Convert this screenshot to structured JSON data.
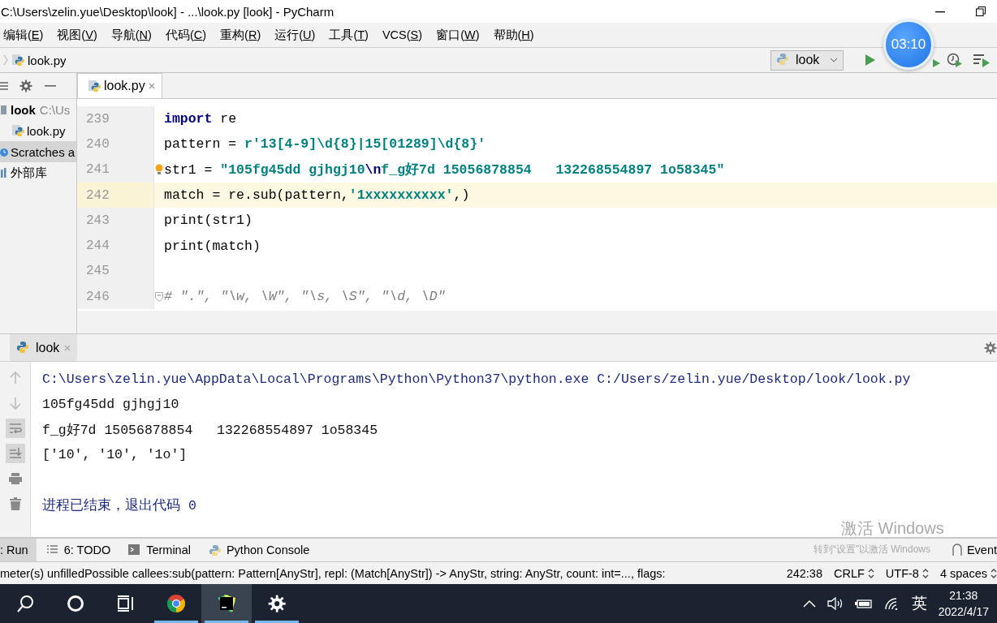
{
  "window": {
    "title": "C:\\Users\\zelin.yue\\Desktop\\look] - ...\\look.py [look] - PyCharm"
  },
  "menu": [
    "编辑(E)",
    "视图(V)",
    "导航(N)",
    "代码(C)",
    "重构(R)",
    "运行(U)",
    "工具(T)",
    "VCS(S)",
    "窗口(W)",
    "帮助(H)"
  ],
  "breadcrumb": {
    "file": "look.py"
  },
  "run_config": {
    "label": "look"
  },
  "timer": {
    "time": "03:10"
  },
  "project": {
    "items": [
      {
        "name": "look",
        "path": "C:\\Us",
        "kind": "folder",
        "selected": false,
        "children": [
          {
            "name": "look.py",
            "kind": "python",
            "selected": false
          }
        ]
      },
      {
        "name": "Scratches a",
        "kind": "scratches",
        "selected": true
      },
      {
        "name": "外部库",
        "kind": "library",
        "selected": false
      }
    ]
  },
  "editor": {
    "tabs": [
      {
        "label": "look.py",
        "selected": true
      }
    ],
    "lines": [
      {
        "number": "239",
        "current": false,
        "tokens": [
          {
            "kind": "keyword",
            "text": "import"
          },
          {
            "kind": "plain",
            "text": " re"
          }
        ]
      },
      {
        "number": "240",
        "current": false,
        "tokens": [
          {
            "kind": "plain",
            "text": "pattern = "
          },
          {
            "kind": "string",
            "text": "r'13[4-9]\\d{8}|15[01289]\\d{8}'"
          }
        ]
      },
      {
        "number": "241",
        "current": false,
        "hint": true,
        "tokens": [
          {
            "kind": "plain",
            "text": "str1 = "
          },
          {
            "kind": "string",
            "text": "\"105fg45dd gjhgj10"
          },
          {
            "kind": "escape",
            "text": "\\n"
          },
          {
            "kind": "string",
            "text": "f_g好7d 15056878854   132268554897 1o58345\""
          }
        ]
      },
      {
        "number": "242",
        "current": true,
        "tokens": [
          {
            "kind": "plain",
            "text": "match = re.sub(pattern,"
          },
          {
            "kind": "string",
            "text": "'1xxxxxxxxxx'"
          },
          {
            "kind": "plain",
            "text": ",)"
          }
        ]
      },
      {
        "number": "243",
        "current": false,
        "tokens": [
          {
            "kind": "plain",
            "text": "print(str1)"
          }
        ]
      },
      {
        "number": "244",
        "current": false,
        "tokens": [
          {
            "kind": "plain",
            "text": "print(match)"
          }
        ]
      },
      {
        "number": "245",
        "current": false
      },
      {
        "number": "246",
        "current": false,
        "fold": true,
        "tokens": [
          {
            "kind": "comment",
            "text": "# \".\", \"\\w, \\W\", \"\\s, \\S\", \"\\d, \\D\""
          }
        ]
      }
    ]
  },
  "run_panel": {
    "tabs": [
      {
        "label": "look",
        "selected": true
      }
    ],
    "output": [
      {
        "kind": "command",
        "text": "C:\\Users\\zelin.yue\\AppData\\Local\\Programs\\Python\\Python37\\python.exe C:/Users/zelin.yue/Desktop/look/look.py"
      },
      {
        "kind": "output",
        "text": "105fg45dd gjhgj10"
      },
      {
        "kind": "output",
        "text": "f_g好7d 15056878854   132268554897 1o58345"
      },
      {
        "kind": "output",
        "text": "['10', '10', '1o']"
      },
      {
        "kind": "exit",
        "text": "进程已结束，退出代码 0"
      }
    ]
  },
  "tool_windows": [
    {
      "label": ": Run",
      "kind": "run",
      "selected": true
    },
    {
      "label": "6: TODO",
      "kind": "todo",
      "selected": false
    },
    {
      "label": "Terminal",
      "kind": "terminal",
      "selected": false
    },
    {
      "label": "Python Console",
      "kind": "python",
      "selected": false
    }
  ],
  "event_log": {
    "label": "Event"
  },
  "activation_notice": {
    "title": "激活 Windows",
    "hint": "转到“设置”以激活 Windows"
  },
  "status_bar": {
    "message": "meter(s) unfilledPossible callees:sub(pattern: Pattern[AnyStr], repl: (Match[AnyStr]) -> AnyStr, string: AnyStr, count: int=..., flags:",
    "position": "242:38",
    "line_separator": "CRLF",
    "encoding": "UTF-8",
    "indent": "4 spaces"
  },
  "taskbar": {
    "apps": [
      {
        "kind": "search",
        "selected": false,
        "running": false
      },
      {
        "kind": "cortana",
        "selected": false,
        "running": false
      },
      {
        "kind": "taskview",
        "selected": false,
        "running": false
      },
      {
        "kind": "chrome",
        "selected": false,
        "running": true
      },
      {
        "kind": "pycharm",
        "selected": true,
        "running": true
      },
      {
        "kind": "settings",
        "selected": false,
        "running": true
      }
    ],
    "ime": "英",
    "time": "21:38",
    "date": "2022/4/17"
  }
}
